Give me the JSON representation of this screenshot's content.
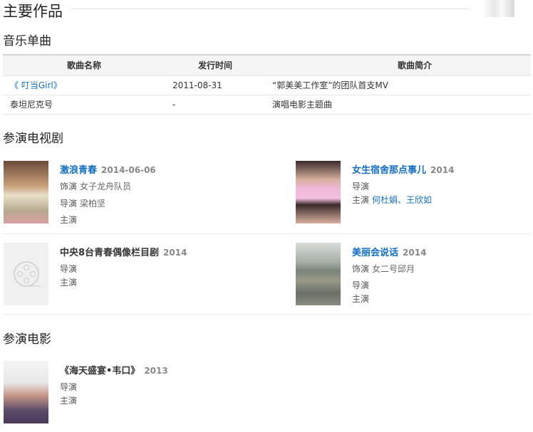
{
  "heading": "主要作品",
  "music": {
    "title": "音乐单曲",
    "headers": [
      "歌曲名称",
      "发行时间",
      "歌曲简介"
    ],
    "rows": [
      [
        "《 叮当Girl》",
        "2011-08-31",
        "“郭美美工作室”的团队首支MV"
      ],
      [
        "泰坦尼克号",
        "-",
        "演唱电影主题曲"
      ]
    ]
  },
  "tv": {
    "title": "参演电视剧",
    "items": [
      {
        "title": "激浪青春",
        "date": "2014-06-06",
        "role_label": "饰演",
        "role": "女子龙舟队员",
        "director_label": "导演",
        "director": "梁柏坚",
        "cast_label": "主演",
        "cast": ""
      },
      {
        "title": "女生宿舍那点事儿",
        "date": "2014",
        "director_label": "导演",
        "cast_label": "主演",
        "cast": "何杜娟、王欣如"
      },
      {
        "title": "中央8台青春偶像栏目剧",
        "date": "2014",
        "director_label": "导演",
        "cast_label": "主演"
      },
      {
        "title": "美丽会说话",
        "date": "2014",
        "role_label": "饰演",
        "role": "女二号邱月",
        "director_label": "导演",
        "cast_label": "主演"
      }
    ]
  },
  "movie": {
    "title": "参演电影",
    "items": [
      {
        "title": "《海天盛宴•韦口》",
        "date": "2013",
        "director_label": "导演",
        "cast_label": "主演"
      }
    ]
  }
}
